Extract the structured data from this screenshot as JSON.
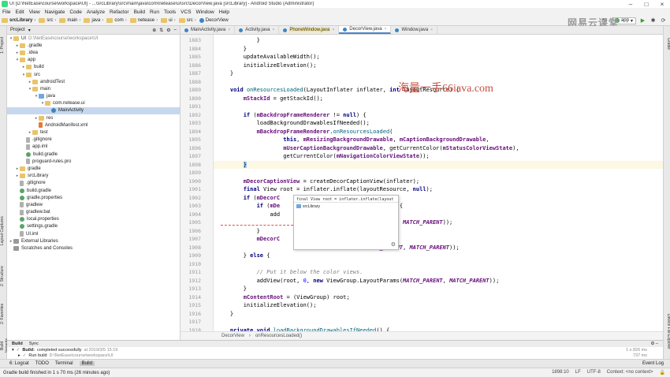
{
  "window": {
    "title": "UI [D:\\NetEase\\course\\workspace\\UI] - ...\\srcLibrary\\src\\main\\java\\com\\netease\\ui\\src\\DecorView.java [srcLibrary] - Android Studio (Administrator)"
  },
  "menu": [
    "File",
    "Edit",
    "View",
    "Navigate",
    "Code",
    "Analyze",
    "Refactor",
    "Build",
    "Run",
    "Tools",
    "VCS",
    "Window",
    "Help"
  ],
  "breadcrumbs": [
    "srcLibrary",
    "src",
    "main",
    "java",
    "com",
    "netease",
    "ui",
    "src",
    "DecorView"
  ],
  "toolbar": {
    "run_config": "app",
    "logo_text": "网易云课堂"
  },
  "left_tabs": [
    "1: Project",
    "Layout Captures",
    "2: Structure",
    "2: Favorites",
    "Build Variants"
  ],
  "right_tabs": [
    "Gradle",
    "Device File Explorer"
  ],
  "project_panel": {
    "title": "Project"
  },
  "tree": [
    {
      "label": "UI",
      "path": "D:\\NetEase\\course\\workspace\\UI",
      "indent": 0,
      "arrow": "▾",
      "icon": "folder"
    },
    {
      "label": ".gradle",
      "indent": 1,
      "arrow": "▸",
      "icon": "folder"
    },
    {
      "label": ".idea",
      "indent": 1,
      "arrow": "▸",
      "icon": "folder"
    },
    {
      "label": "app",
      "indent": 1,
      "arrow": "▾",
      "icon": "folder"
    },
    {
      "label": "build",
      "indent": 2,
      "arrow": "▸",
      "icon": "folder"
    },
    {
      "label": "src",
      "indent": 2,
      "arrow": "▾",
      "icon": "folder"
    },
    {
      "label": "androidTest",
      "indent": 3,
      "arrow": "▸",
      "icon": "folder"
    },
    {
      "label": "main",
      "indent": 3,
      "arrow": "▾",
      "icon": "folder"
    },
    {
      "label": "java",
      "indent": 4,
      "arrow": "▾",
      "icon": "src-folder"
    },
    {
      "label": "com.netease.ui",
      "indent": 5,
      "arrow": "▾",
      "icon": "folder"
    },
    {
      "label": "MainActivity",
      "indent": 6,
      "arrow": "",
      "icon": "class",
      "selected": true
    },
    {
      "label": "res",
      "indent": 4,
      "arrow": "▸",
      "icon": "folder"
    },
    {
      "label": "AndroidManifest.xml",
      "indent": 4,
      "arrow": "",
      "icon": "xml"
    },
    {
      "label": "test",
      "indent": 3,
      "arrow": "▸",
      "icon": "folder"
    },
    {
      "label": ".gitignore",
      "indent": 2,
      "arrow": "",
      "icon": "file"
    },
    {
      "label": "app.iml",
      "indent": 2,
      "arrow": "",
      "icon": "file"
    },
    {
      "label": "build.gradle",
      "indent": 2,
      "arrow": "",
      "icon": "gradle"
    },
    {
      "label": "proguard-rules.pro",
      "indent": 2,
      "arrow": "",
      "icon": "file"
    },
    {
      "label": "gradle",
      "indent": 1,
      "arrow": "▸",
      "icon": "folder"
    },
    {
      "label": "srcLibrary",
      "indent": 1,
      "arrow": "▸",
      "icon": "folder"
    },
    {
      "label": ".gitignore",
      "indent": 1,
      "arrow": "",
      "icon": "file"
    },
    {
      "label": "build.gradle",
      "indent": 1,
      "arrow": "",
      "icon": "gradle"
    },
    {
      "label": "gradle.properties",
      "indent": 1,
      "arrow": "",
      "icon": "gradle"
    },
    {
      "label": "gradlew",
      "indent": 1,
      "arrow": "",
      "icon": "file"
    },
    {
      "label": "gradlew.bat",
      "indent": 1,
      "arrow": "",
      "icon": "file"
    },
    {
      "label": "local.properties",
      "indent": 1,
      "arrow": "",
      "icon": "gradle"
    },
    {
      "label": "settings.gradle",
      "indent": 1,
      "arrow": "",
      "icon": "gradle"
    },
    {
      "label": "UI.iml",
      "indent": 1,
      "arrow": "",
      "icon": "file"
    },
    {
      "label": "External Libraries",
      "indent": 0,
      "arrow": "▸",
      "icon": "lib"
    },
    {
      "label": "Scratches and Consoles",
      "indent": 0,
      "arrow": "",
      "icon": "lib"
    }
  ],
  "editor_tabs": [
    {
      "label": "MainActivity.java",
      "active": false
    },
    {
      "label": "Activity.java",
      "active": false
    },
    {
      "label": "PhoneWindow.java",
      "active": false,
      "hl": true
    },
    {
      "label": "DecorView.java",
      "active": true
    },
    {
      "label": "Window.java",
      "active": false
    }
  ],
  "code_lines": [
    {
      "n": "1883",
      "h": "            }"
    },
    {
      "n": "1884",
      "h": "        }"
    },
    {
      "n": "1885",
      "h": "        updateAvailableWidth();"
    },
    {
      "n": "1886",
      "h": "        initializeElevation();"
    },
    {
      "n": "1887",
      "h": "    }"
    },
    {
      "n": "1888",
      "h": ""
    },
    {
      "n": "1889",
      "h": "    <k>void</k> <f>onResourcesLoaded</f>(LayoutInflater inflater, <k>int</k> layoutResource) {"
    },
    {
      "n": "1890",
      "h": "        <d>mStackId</d> = getStackId();"
    },
    {
      "n": "1891",
      "h": ""
    },
    {
      "n": "1892",
      "h": "        <k>if</k> (<d>mBackdropFrameRenderer</d> != <k>null</k>) {"
    },
    {
      "n": "1893",
      "h": "            loadBackgroundDrawablesIfNeeded();"
    },
    {
      "n": "1894",
      "h": "            <d>mBackdropFrameRenderer</d>.<f>onResourcesLoaded</f>("
    },
    {
      "n": "1895",
      "h": "                    <k>this</k>, <d>mResizingBackgroundDrawable</d>, <d>mCaptionBackgroundDrawable</d>,"
    },
    {
      "n": "1896",
      "h": "                    <d>mUserCaptionBackgroundDrawable</d>, getCurrentColor(<d>mStatusColorViewState</d>),"
    },
    {
      "n": "1897",
      "h": "                    getCurrentColor(<d>mNavigationColorViewState</d>));"
    },
    {
      "n": "1898",
      "h": "        <b>}</b>"
    },
    {
      "n": "1899",
      "h": ""
    },
    {
      "n": "1900",
      "h": "        <d>mDecorCaptionView</d> = createDecorCaptionView(inflater);"
    },
    {
      "n": "1901",
      "h": "        <k>final</k> View root = inflater.inflate(layoutResource, <k>null</k>);"
    },
    {
      "n": "1902",
      "h": "        <k>if</k> (<d>mDecorC</d>"
    },
    {
      "n": "1903",
      "h": "            <k>if</k> (<d>mDe</d>                           == <k>null</k>) {"
    },
    {
      "n": "1904",
      "h": "                add"
    },
    {
      "n": "1905",
      "h": "                                          <c>MATCH_PARENT</c>, <c>MATCH_PARENT</c>));"
    },
    {
      "n": "1906",
      "h": "            }"
    },
    {
      "n": "1907",
      "h": "            <d>mDecorC</d>"
    },
    {
      "n": "1908",
      "h": "                                            <c>MATCH_PARENT</c>, <c>MATCH_PARENT</c>));"
    },
    {
      "n": "1909",
      "h": "        } <k>else</k> {"
    },
    {
      "n": "1910",
      "h": ""
    },
    {
      "n": "1911",
      "h": "            <m>// Put it below the color views.</m>"
    },
    {
      "n": "1912",
      "h": "            addView(root, <n>0</n>, <k>new</k> ViewGroup.LayoutParams(<c>MATCH_PARENT</c>, <c>MATCH_PARENT</c>));"
    },
    {
      "n": "1913",
      "h": "        }"
    },
    {
      "n": "1914",
      "h": "        <d>mContentRoot</d> = (ViewGroup) root;"
    },
    {
      "n": "1915",
      "h": "        initializeElevation();"
    },
    {
      "n": "1916",
      "h": "    }"
    },
    {
      "n": "1917",
      "h": ""
    },
    {
      "n": "1918",
      "h": "    <k>private void</k> <f>loadBackgroundDrawablesIfNeeded</f>() {"
    }
  ],
  "popup": {
    "header": "final View root = inflater.inflate(layout",
    "item": "srcLibrary"
  },
  "watermark": "海量一手66iava.com",
  "editor_breadcrumb": [
    "DecorView",
    "onResourcesLoaded()"
  ],
  "build_panel": {
    "tabs": [
      "Build",
      "Sync"
    ],
    "row1_status": "Build:",
    "row1_text": "completed successfully",
    "row1_at": "at 2019/3/5 15:19",
    "row1_time": "1 s 826 ms",
    "row2_text": "Run build",
    "row2_path": "D:\\NetEase\\course\\workspace\\UI",
    "row2_time": "737 ms"
  },
  "bottom_tabs": [
    "6: Logcat",
    "TODO",
    "Terminal",
    "Build"
  ],
  "event_log": "Event Log",
  "status": {
    "message": "Gradle build finished in 1 s 70 ms (26 minutes ago)",
    "position": "1898:10",
    "line_ending": "LF",
    "encoding": "UTF-8",
    "context": "Context: <no context>"
  }
}
